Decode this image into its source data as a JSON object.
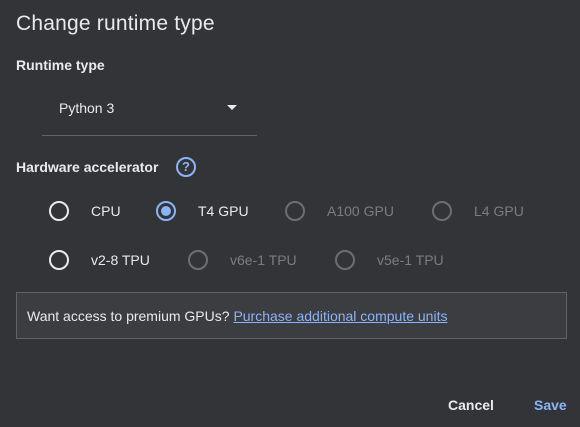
{
  "dialog": {
    "title": "Change runtime type"
  },
  "runtime": {
    "label": "Runtime type",
    "selected": "Python 3"
  },
  "hardware": {
    "label": "Hardware accelerator",
    "help_icon": "help-icon",
    "options": [
      {
        "label": "CPU",
        "selected": false,
        "disabled": false
      },
      {
        "label": "T4 GPU",
        "selected": true,
        "disabled": false
      },
      {
        "label": "A100 GPU",
        "selected": false,
        "disabled": true
      },
      {
        "label": "L4 GPU",
        "selected": false,
        "disabled": true
      },
      {
        "label": "v2-8 TPU",
        "selected": false,
        "disabled": false
      },
      {
        "label": "v6e-1 TPU",
        "selected": false,
        "disabled": true
      },
      {
        "label": "v5e-1 TPU",
        "selected": false,
        "disabled": true
      }
    ]
  },
  "notice": {
    "text": "Want access to premium GPUs?",
    "link": "Purchase additional compute units"
  },
  "buttons": {
    "cancel": "Cancel",
    "save": "Save"
  },
  "colors": {
    "background": "#333437",
    "accent": "#8ab4f8",
    "text": "#e8eaed",
    "disabled": "#7b7d80"
  }
}
